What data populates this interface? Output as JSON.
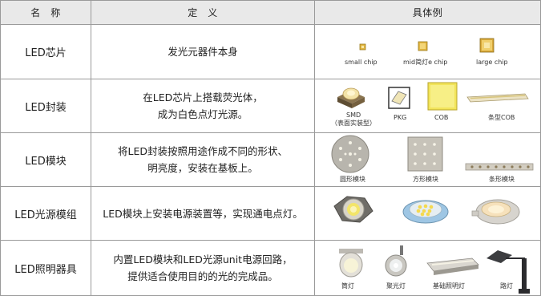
{
  "header": {
    "name": "名　称",
    "definition": "定　义",
    "example": "具体例"
  },
  "rows": [
    {
      "name": "LED芯片",
      "definition": [
        "发光元器件本身"
      ],
      "examples": [
        "small chip",
        "mid简灯e chip",
        "large chip"
      ]
    },
    {
      "name": "LED封装",
      "definition": [
        "在LED芯片上搭载荧光体，",
        "成为白色点灯光源。"
      ],
      "examples": [
        "SMD",
        "（表面实装型）",
        "PKG",
        "COB",
        "条型COB"
      ]
    },
    {
      "name": "LED模块",
      "definition": [
        "将LED封装按照用途作成不同的形状、",
        "明亮度，安装在基板上。"
      ],
      "examples": [
        "圆形模块",
        "方形模块",
        "条形模块"
      ]
    },
    {
      "name": "LED光源模组",
      "definition": [
        "LED模块上安装电源装置等，实现通电点灯。"
      ],
      "examples": []
    },
    {
      "name": "LED照明器具",
      "definition": [
        "内置LED模块和LED光源unit电源回路，",
        "提供适合使用目的的光的完成品。"
      ],
      "examples": [
        "筒灯",
        "聚光灯",
        "基础照明灯",
        "路灯"
      ]
    }
  ]
}
